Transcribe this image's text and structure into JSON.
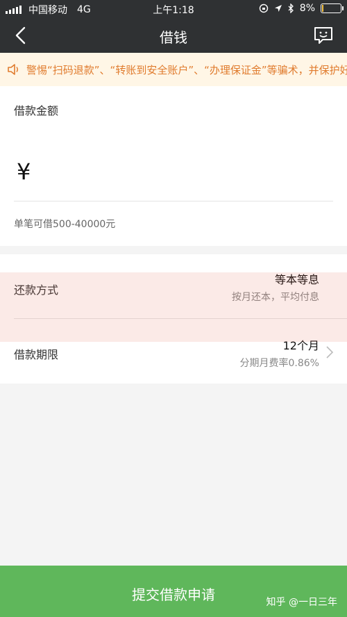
{
  "status_bar": {
    "carrier": "中国移动",
    "network": "4G",
    "time": "上午1:18",
    "battery_text": "8%",
    "battery_level": 0.08,
    "battery_color": "#f5c242"
  },
  "navbar": {
    "title": "借钱",
    "back_icon": "chevron-left-icon",
    "chat_icon": "feedback-chat-icon"
  },
  "notice": {
    "icon": "speaker-icon",
    "text": "警惕“扫码退款”、“转账到安全账户”、“办理保证金”等骗术，并保护好",
    "color": "#e07b2d"
  },
  "loan_amount": {
    "label": "借款金额",
    "currency_symbol": "¥",
    "input_value": "",
    "hint": "单笔可借500-40000元"
  },
  "repayment": {
    "label": "还款方式",
    "value": "等本等息",
    "sub": "按月还本，平均付息"
  },
  "term": {
    "label": "借款期限",
    "value": "12个月",
    "sub": "分期月费率0.86%"
  },
  "submit": {
    "label": "提交借款申请",
    "watermark": "知乎 @一日三年",
    "color": "#5fb75b"
  }
}
